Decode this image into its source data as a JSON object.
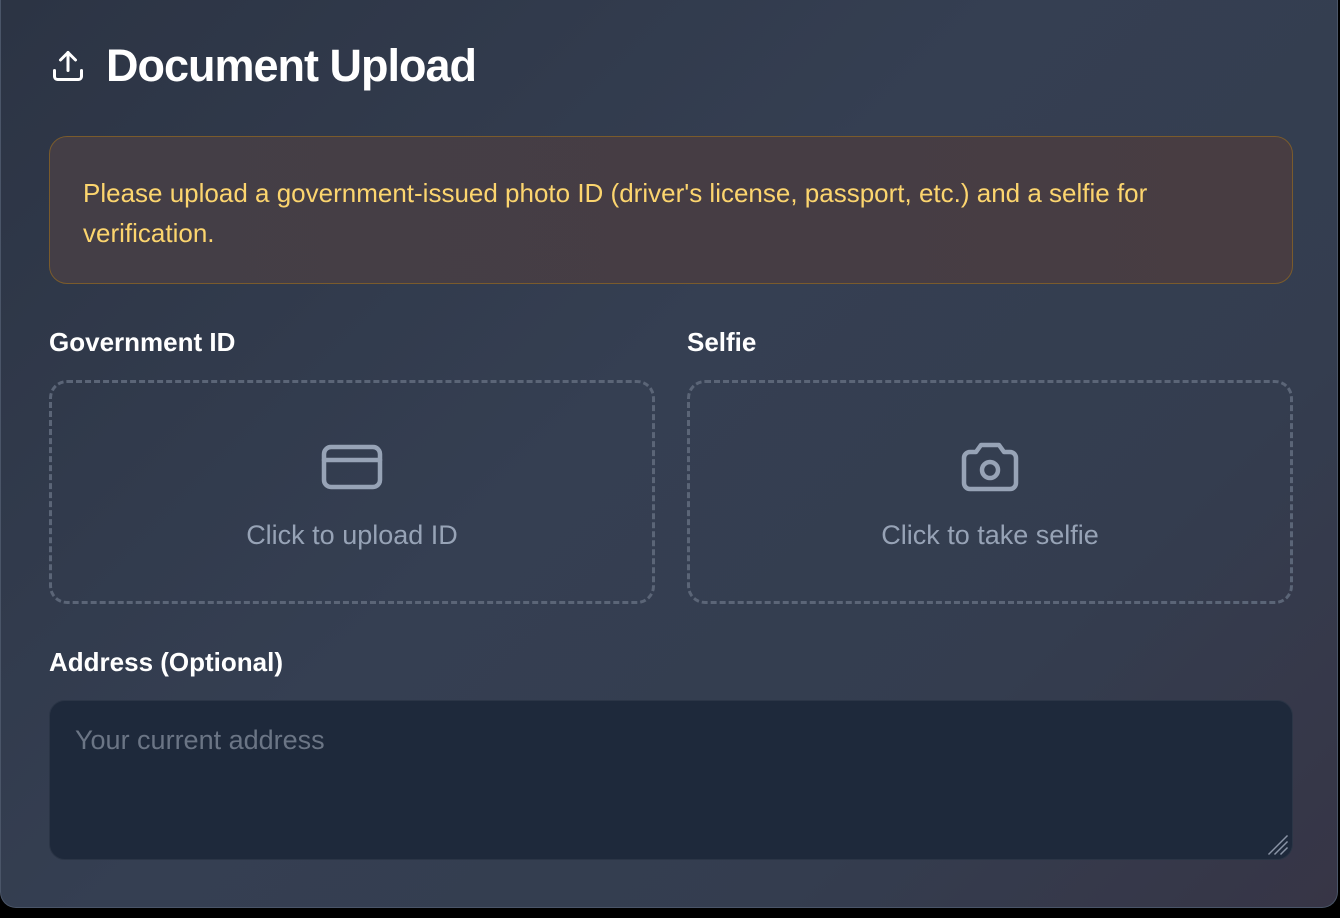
{
  "header": {
    "icon": "upload-icon",
    "title": "Document Upload"
  },
  "notice": {
    "text": "Please upload a government-issued photo ID (driver's license, passport, etc.) and a selfie for verification."
  },
  "government_id": {
    "label": "Government ID",
    "icon": "id-card-icon",
    "prompt": "Click to upload ID"
  },
  "selfie": {
    "label": "Selfie",
    "icon": "camera-icon",
    "prompt": "Click to take selfie"
  },
  "address": {
    "label": "Address (Optional)",
    "value": "",
    "placeholder": "Your current address"
  },
  "colors": {
    "notice_text": "#fcd56e",
    "notice_border": "#7a5b2c",
    "icon": "#97a3b6",
    "input_bg": "#1e293b"
  }
}
